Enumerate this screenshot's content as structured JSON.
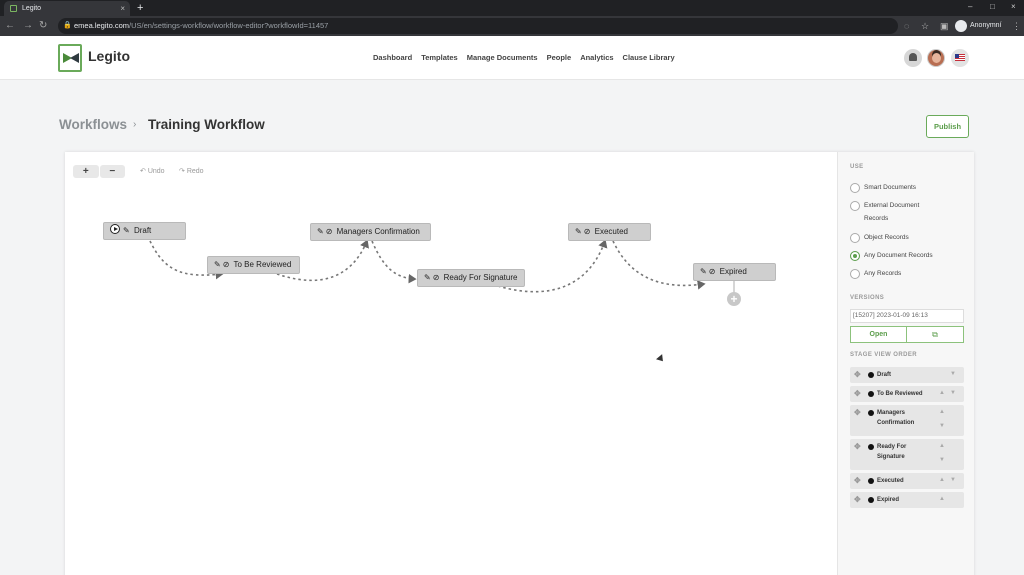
{
  "browser": {
    "tab_title": "Legito",
    "tab_close": "×",
    "new_tab": "+",
    "url_host": "emea.legito.com",
    "url_path": "/US/en/settings-workflow/workflow-editor?workflowId=11457",
    "profile_name": "Anonymní",
    "window_controls": [
      "–",
      "□",
      "×"
    ]
  },
  "header": {
    "logo_text": "Legito",
    "nav": [
      "Dashboard",
      "Templates",
      "Manage Documents",
      "People",
      "Analytics",
      "Clause Library"
    ]
  },
  "page": {
    "breadcrumb_root": "Workflows",
    "breadcrumb_sep": "›",
    "title": "Training Workflow",
    "publish_label": "Publish"
  },
  "toolbar": {
    "zoom_in": "+",
    "zoom_out": "−",
    "undo": "Undo",
    "redo": "Redo"
  },
  "stages": [
    {
      "name": "Draft",
      "start": true
    },
    {
      "name": "To Be Reviewed"
    },
    {
      "name": "Managers Confirmation"
    },
    {
      "name": "Ready For Signature"
    },
    {
      "name": "Executed"
    },
    {
      "name": "Expired"
    }
  ],
  "add_stage": "+",
  "panel": {
    "use_title": "USE",
    "use_options": [
      "Smart Documents",
      "External Document",
      "Records",
      "Object Records",
      "Any Document Records",
      "Any Records"
    ],
    "use_selected": "Any Document Records",
    "versions_title": "VERSIONS",
    "version_value": "[15207] 2023-01-09 16:13",
    "open_label": "Open",
    "stage_view_order_title": "STAGE VIEW ORDER",
    "order": [
      {
        "line1": "Draft",
        "line2": ""
      },
      {
        "line1": "To Be Reviewed",
        "line2": ""
      },
      {
        "line1": "Managers",
        "line2": "Confirmation"
      },
      {
        "line1": "Ready For",
        "line2": "Signature"
      },
      {
        "line1": "Executed",
        "line2": ""
      },
      {
        "line1": "Expired",
        "line2": ""
      }
    ]
  },
  "colors": {
    "brand_green": "#5c9e4c",
    "stage_fill": "#cfcfcf"
  }
}
